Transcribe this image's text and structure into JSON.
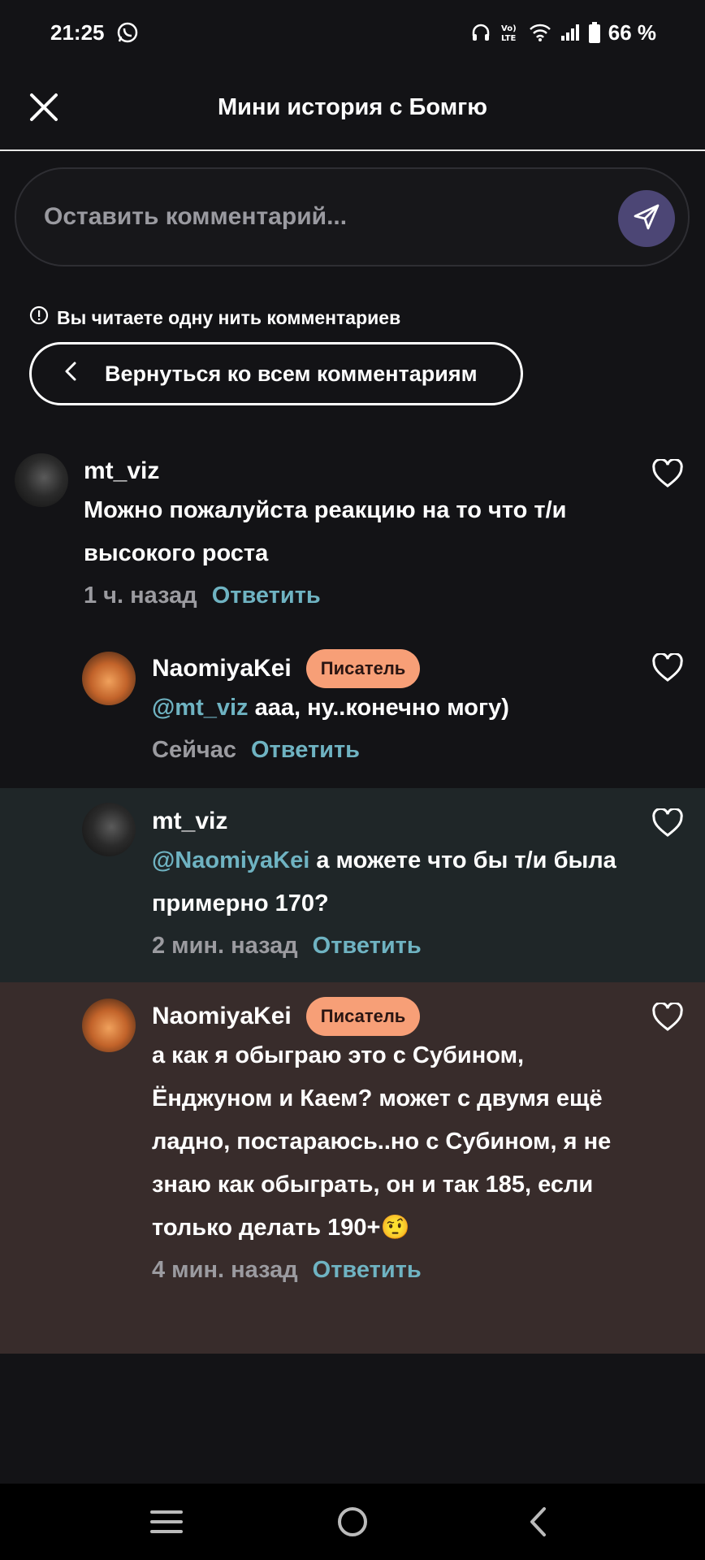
{
  "status_bar": {
    "time": "21:25",
    "battery": "66 %",
    "icons": [
      "whatsapp-icon",
      "headphones-icon",
      "volte-icon",
      "wifi-icon",
      "signal-icon",
      "battery-icon"
    ]
  },
  "header": {
    "title": "Мини история с Бомгю",
    "close_icon": "close-icon"
  },
  "comment_input": {
    "placeholder": "Оставить комментарий...",
    "send_icon": "send-icon"
  },
  "thread_notice": {
    "text": "Вы читаете одну нить комментариев",
    "icon": "info-icon"
  },
  "back_button": {
    "label": "Вернуться ко всем комментариям",
    "icon": "chevron-left-icon"
  },
  "comments": [
    {
      "user": "mt_viz",
      "badge": "",
      "mention": "",
      "text": "Можно пожалуйста реакцию на то что т/и высокого роста",
      "time": "1 ч. назад",
      "reply": "Ответить",
      "background": "#131316"
    },
    {
      "user": "NaomiyaKei",
      "badge": "Писатель",
      "mention": "@mt_viz",
      "text": " ааа, ну..конечно могу)",
      "time": "Сейчас",
      "reply": "Ответить",
      "background": "#131316"
    },
    {
      "user": "mt_viz",
      "badge": "",
      "mention": "@NaomiyaKei",
      "text": " а можете что бы т/и была примерно 170?",
      "time": "2 мин. назад",
      "reply": "Ответить",
      "background": "#1f2628"
    },
    {
      "user": "NaomiyaKei",
      "badge": "Писатель",
      "mention": "",
      "text": "а как я обыграю это с Субином, Ёнджуном и Каем? может с двумя ещё ладно, постараюсь..но с Субином, я не знаю как обыграть, он и так 185, если только делать 190+🤨",
      "time": "4 мин. назад",
      "reply": "Ответить",
      "background": "#382c2b"
    }
  ],
  "nav_bar": {
    "icons": [
      "recent-apps-icon",
      "home-icon",
      "back-icon"
    ]
  },
  "colors": {
    "background": "#131316",
    "accent": "#6fb3c2",
    "badge": "#f79f77",
    "send_button": "#4c4675"
  }
}
